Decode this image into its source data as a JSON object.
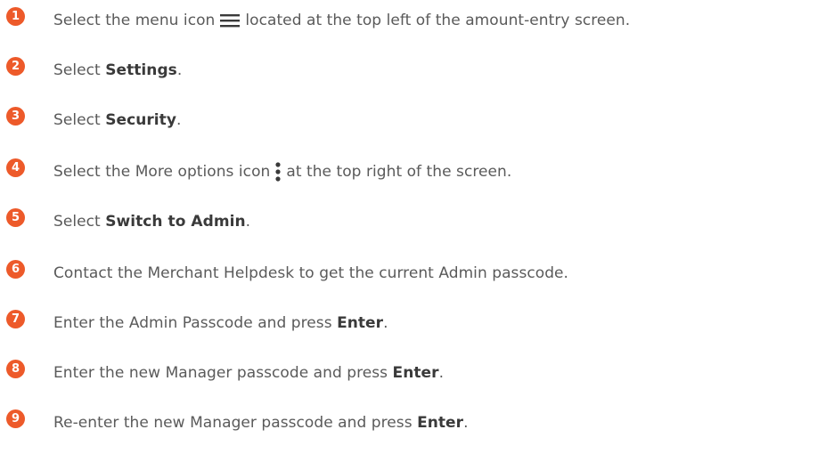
{
  "accent_color": "#ed5a2a",
  "steps": [
    {
      "number": "1",
      "before": "Select the menu icon",
      "icon": "hamburger-menu-icon",
      "after": "located at the top left of the amount-entry screen."
    },
    {
      "number": "2",
      "before": "Select ",
      "bold": "Settings",
      "after": "."
    },
    {
      "number": "3",
      "before": "Select ",
      "bold": "Security",
      "after": "."
    },
    {
      "number": "4",
      "before": "Select the More options icon",
      "icon": "more-options-icon",
      "after": "at the top right of the screen."
    },
    {
      "number": "5",
      "before": "Select ",
      "bold": "Switch to Admin",
      "after": "."
    },
    {
      "number": "6",
      "before": "Contact the Merchant Helpdesk to get the current Admin passcode."
    },
    {
      "number": "7",
      "before": "Enter the Admin Passcode and press ",
      "bold": "Enter",
      "after": "."
    },
    {
      "number": "8",
      "before": "Enter the new Manager passcode and press ",
      "bold": "Enter",
      "after": "."
    },
    {
      "number": "9",
      "before": "Re-enter the new Manager passcode and press ",
      "bold": "Enter",
      "after": "."
    }
  ]
}
